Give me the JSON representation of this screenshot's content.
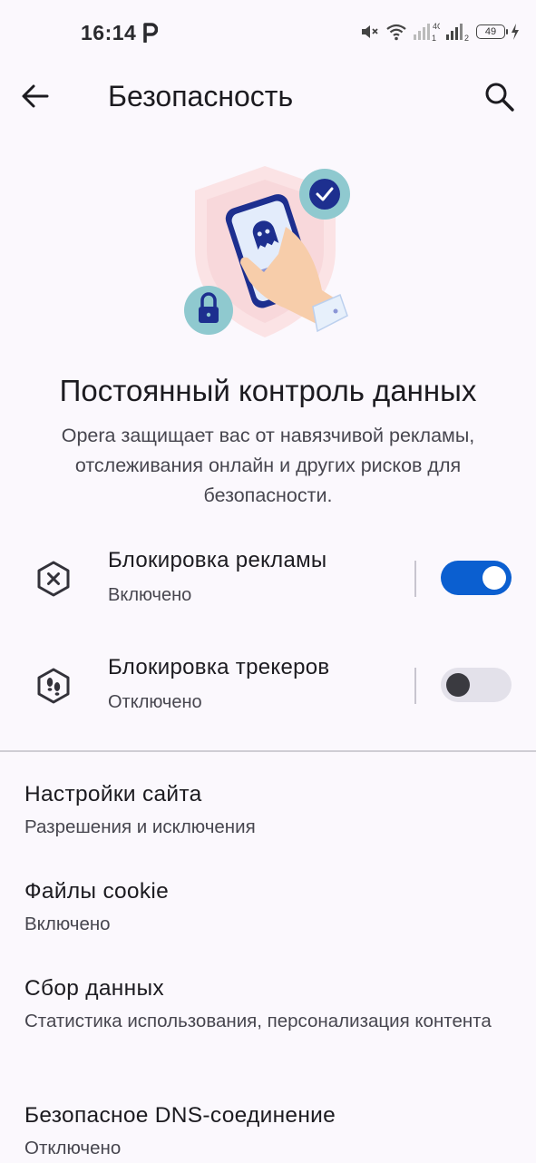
{
  "status_bar": {
    "time": "16:14",
    "network_label": "4G",
    "sim1": "1",
    "sim2": "2",
    "battery": "49"
  },
  "app_bar": {
    "title": "Безопасность",
    "back_icon": "arrow-left",
    "search_icon": "search"
  },
  "hero": {
    "headline": "Постоянный контроль данных",
    "description": "Opera защищает вас от навязчивой рекламы, отслеживания онлайн и других рисков для безопасности."
  },
  "toggles": [
    {
      "title": "Блокировка рекламы",
      "status": "Включено",
      "enabled": true,
      "icon": "ad-block-icon"
    },
    {
      "title": "Блокировка трекеров",
      "status": "Отключено",
      "enabled": false,
      "icon": "tracker-block-icon"
    }
  ],
  "settings": [
    {
      "title": "Настройки сайта",
      "subtitle": "Разрешения и исключения"
    },
    {
      "title": "Файлы cookie",
      "subtitle": "Включено"
    },
    {
      "title": "Сбор данных",
      "subtitle": "Статистика использования, персонализация контента"
    },
    {
      "title": "Безопасное DNS-соединение",
      "subtitle": "Отключено"
    }
  ],
  "colors": {
    "background": "#fbf8fd",
    "accent": "#0b5fd0",
    "illustration_navy": "#1d2f8f",
    "illustration_teal": "#8fc9cf"
  }
}
